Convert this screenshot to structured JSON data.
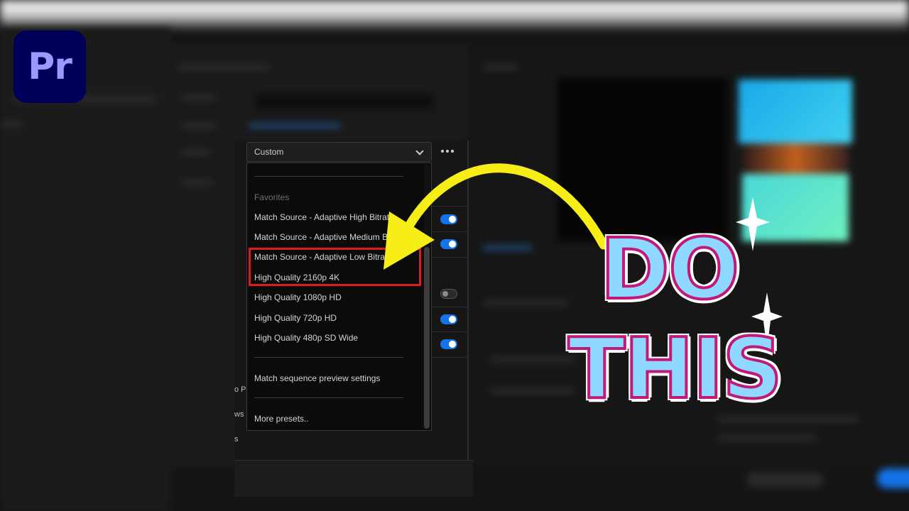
{
  "app": {
    "logo_text": "Pr"
  },
  "preset": {
    "selected": "Custom",
    "dropdown": {
      "favorites_header": "Favorites",
      "items": [
        "Match Source - Adaptive High Bitrate",
        "Match Source - Adaptive Medium Bitrate",
        "Match Source - Adaptive Low Bitrate",
        "High Quality 2160p 4K",
        "High Quality 1080p HD",
        "High Quality 720p HD",
        "High Quality 480p SD Wide"
      ],
      "match_sequence": "Match sequence preview settings",
      "more_presets": "More presets.."
    }
  },
  "toggles": [
    true,
    true,
    false,
    true,
    true
  ],
  "side_labels": [
    "o Pr",
    "ws",
    "s"
  ],
  "overlay": {
    "line1": "DO",
    "line2": "THIS"
  },
  "colors": {
    "accent_blue": "#1473e6",
    "highlight_red": "#e01a1a",
    "arrow_yellow": "#f7ee17",
    "text_fill": "#8fd8ff",
    "text_outline": "#c2187a"
  }
}
